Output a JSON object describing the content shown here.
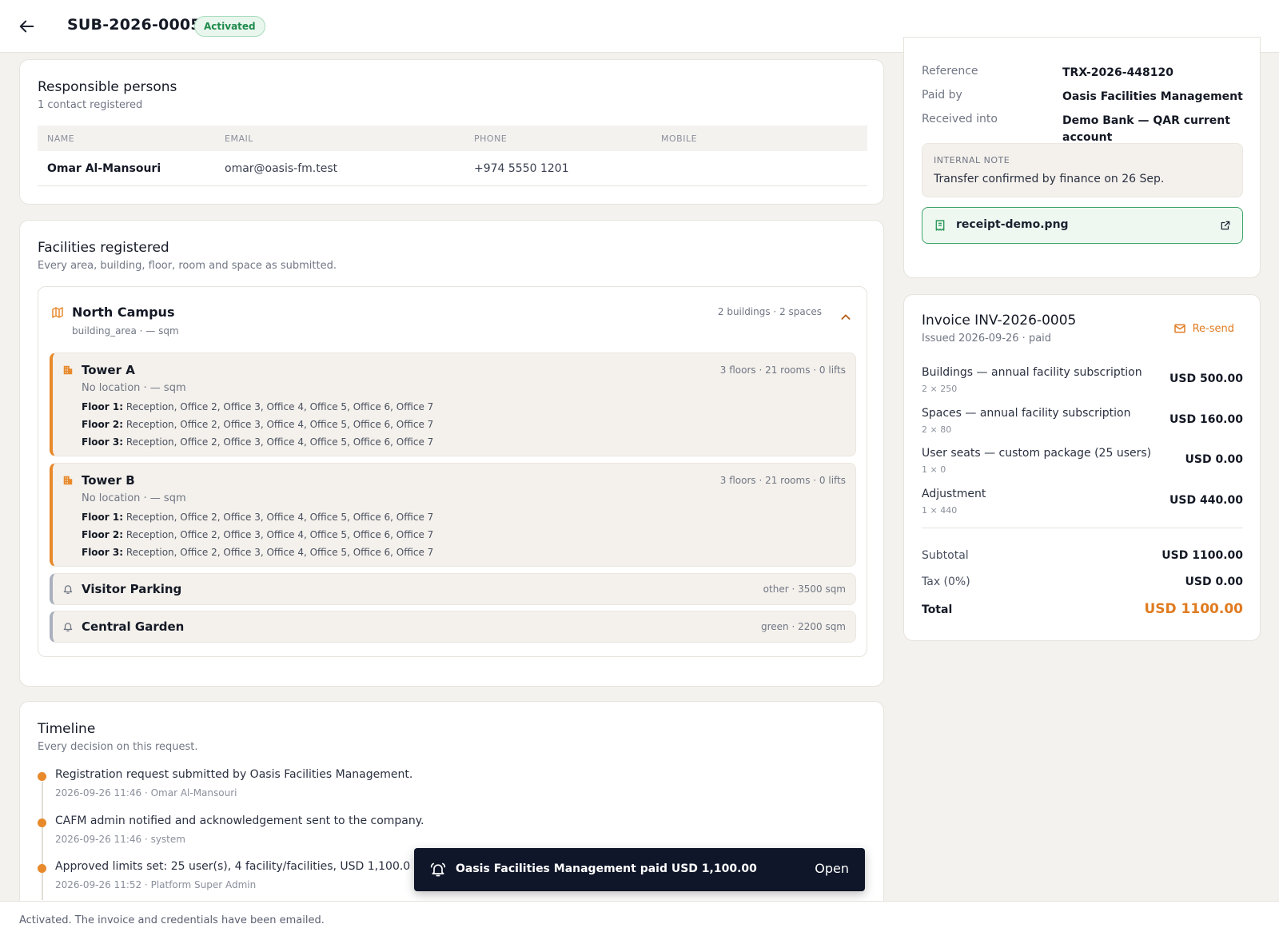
{
  "header": {
    "title": "SUB-2026-0005",
    "status": "Activated"
  },
  "contacts": {
    "title": "Responsible persons",
    "subtitle": "1 contact registered",
    "columns": [
      "NAME",
      "EMAIL",
      "PHONE",
      "MOBILE"
    ],
    "rows": [
      {
        "name": "Omar Al-Mansouri",
        "email": "omar@oasis-fm.test",
        "phone": "+974 5550 1201",
        "mobile": ""
      }
    ]
  },
  "facilities": {
    "title": "Facilities registered",
    "subtitle": "Every area, building, floor, room and space as submitted.",
    "campus": {
      "name": "North Campus",
      "meta": "building_area · — sqm",
      "count": "2 buildings · 2 spaces",
      "buildings": [
        {
          "name": "Tower A",
          "meta": "No location · — sqm",
          "count": "3 floors · 21 rooms · 0 lifts",
          "floors": [
            {
              "label": "Floor 1:",
              "rooms": "Reception, Office 2, Office 3, Office 4, Office 5, Office 6, Office 7"
            },
            {
              "label": "Floor 2:",
              "rooms": "Reception, Office 2, Office 3, Office 4, Office 5, Office 6, Office 7"
            },
            {
              "label": "Floor 3:",
              "rooms": "Reception, Office 2, Office 3, Office 4, Office 5, Office 6, Office 7"
            }
          ]
        },
        {
          "name": "Tower B",
          "meta": "No location · — sqm",
          "count": "3 floors · 21 rooms · 0 lifts",
          "floors": [
            {
              "label": "Floor 1:",
              "rooms": "Reception, Office 2, Office 3, Office 4, Office 5, Office 6, Office 7"
            },
            {
              "label": "Floor 2:",
              "rooms": "Reception, Office 2, Office 3, Office 4, Office 5, Office 6, Office 7"
            },
            {
              "label": "Floor 3:",
              "rooms": "Reception, Office 2, Office 3, Office 4, Office 5, Office 6, Office 7"
            }
          ]
        }
      ],
      "spaces": [
        {
          "name": "Visitor Parking",
          "meta": "other · 3500 sqm"
        },
        {
          "name": "Central Garden",
          "meta": "green · 2200 sqm"
        }
      ]
    }
  },
  "timeline": {
    "title": "Timeline",
    "subtitle": "Every decision on this request.",
    "events": [
      {
        "text": "Registration request submitted by Oasis Facilities Management.",
        "meta": "2026-09-26 11:46 · Omar Al-Mansouri"
      },
      {
        "text": "CAFM admin notified and acknowledgement sent to the company.",
        "meta": "2026-09-26 11:46 · system"
      },
      {
        "text": "Approved limits set: 25 user(s), 4 facility/facilities, USD 1,100.0",
        "meta": "2026-09-26 11:52 · Platform Super Admin"
      }
    ]
  },
  "payment": {
    "reference_label": "Reference",
    "reference": "TRX-2026-448120",
    "paid_by_label": "Paid by",
    "paid_by": "Oasis Facilities Management",
    "received_label": "Received into",
    "received": "Demo Bank — QAR current account",
    "note_label": "INTERNAL NOTE",
    "note": "Transfer confirmed by finance on 26 Sep.",
    "receipt": "receipt-demo.png"
  },
  "invoice": {
    "title": "Invoice INV-2026-0005",
    "subtitle": "Issued 2026-09-26 · paid",
    "resend": "Re-send",
    "items": [
      {
        "name": "Buildings — annual facility subscription",
        "qty": "2 × 250",
        "amount": "USD 500.00"
      },
      {
        "name": "Spaces — annual facility subscription",
        "qty": "2 × 80",
        "amount": "USD 160.00"
      },
      {
        "name": "User seats — custom package (25 users)",
        "qty": "1 × 0",
        "amount": "USD 0.00"
      },
      {
        "name": "Adjustment",
        "qty": "1 × 440",
        "amount": "USD 440.00"
      }
    ],
    "subtotal_label": "Subtotal",
    "subtotal": "USD 1100.00",
    "tax_label": "Tax (0%)",
    "tax": "USD 0.00",
    "total_label": "Total",
    "total": "USD 1100.00"
  },
  "toast": {
    "message": "Oasis Facilities Management paid USD 1,100.00",
    "action": "Open"
  },
  "footer": {
    "message": "Activated. The invoice and credentials have been emailed."
  },
  "colors": {
    "accent": "#e8892b",
    "success": "#1f8a4c",
    "toast_bg": "#0f1629"
  }
}
